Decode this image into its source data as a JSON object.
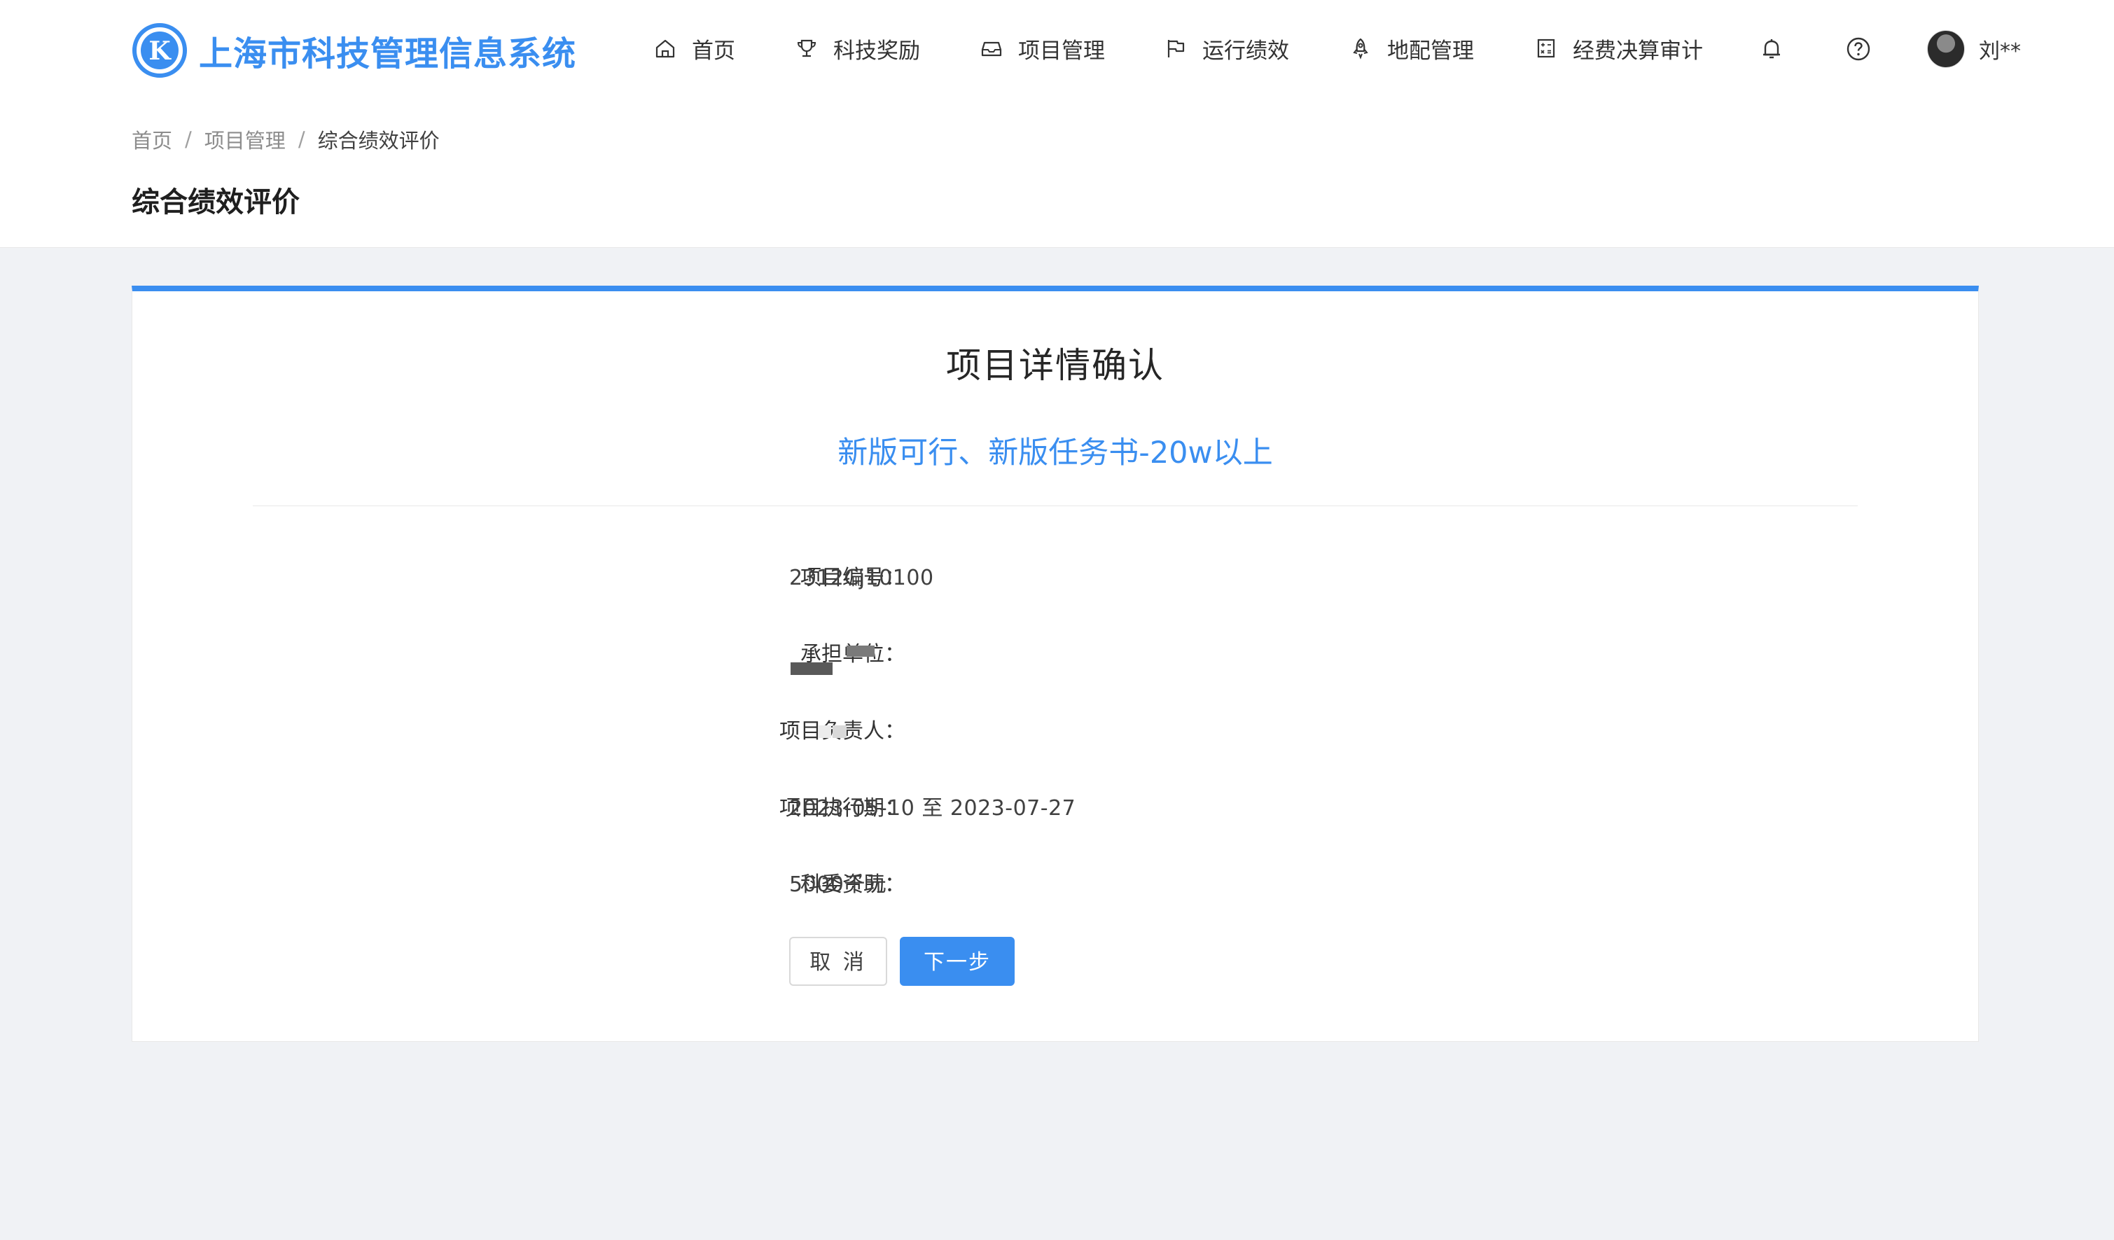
{
  "app": {
    "title": "上海市科技管理信息系统",
    "logo_letter": "K"
  },
  "nav": {
    "items": [
      {
        "label": "首页",
        "icon": "home-icon"
      },
      {
        "label": "科技奖励",
        "icon": "trophy-icon"
      },
      {
        "label": "项目管理",
        "icon": "inbox-icon"
      },
      {
        "label": "运行绩效",
        "icon": "flag-icon"
      },
      {
        "label": "地配管理",
        "icon": "rocket-icon"
      },
      {
        "label": "经费决算审计",
        "icon": "calculator-icon"
      }
    ],
    "notification_icon": "bell-icon",
    "help_icon": "question-circle-icon"
  },
  "user": {
    "name": "刘**"
  },
  "breadcrumb": [
    {
      "label": "首页"
    },
    {
      "label": "项目管理"
    },
    {
      "label": "综合绩效评价"
    }
  ],
  "page": {
    "title": "综合绩效评价"
  },
  "card": {
    "title": "项目详情确认",
    "subtitle": "新版可行、新版任务书-20w以上",
    "fields": [
      {
        "label": "项目编号：",
        "value": "2312Cj10100"
      },
      {
        "label": "承担单位：",
        "value": ""
      },
      {
        "label": "项目负责人：",
        "value": ""
      },
      {
        "label": "项目执行期：",
        "value": "2023-05-10 至 2023-07-27"
      },
      {
        "label": "科委资助：",
        "value": "5000千元"
      }
    ],
    "cancel_label": "取 消",
    "next_label": "下一步"
  },
  "colors": {
    "primary": "#3a8ef0",
    "page_background": "#f0f2f5"
  }
}
